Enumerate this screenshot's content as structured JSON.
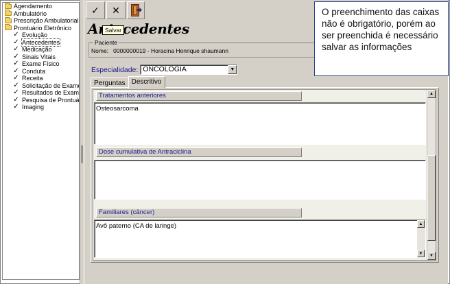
{
  "tree": {
    "items": [
      {
        "label": "Agendamento",
        "level": 0,
        "icon": "folder-icon"
      },
      {
        "label": "Ambulatório",
        "level": 0,
        "icon": "folder-icon"
      },
      {
        "label": "Prescrição Ambulatorial",
        "level": 0,
        "icon": "folder-icon"
      },
      {
        "label": "Prontuário Eletrônico",
        "level": 0,
        "icon": "folder-open-icon"
      },
      {
        "label": "Evolução",
        "level": 1,
        "icon": "check-icon"
      },
      {
        "label": "Antecedentes",
        "level": 1,
        "icon": "check-icon",
        "selected": true
      },
      {
        "label": "Medicação",
        "level": 1,
        "icon": "check-icon"
      },
      {
        "label": "Sinais Vitais",
        "level": 1,
        "icon": "check-icon"
      },
      {
        "label": "Exame Físico",
        "level": 1,
        "icon": "check-icon"
      },
      {
        "label": "Conduta",
        "level": 1,
        "icon": "check-icon"
      },
      {
        "label": "Receita",
        "level": 1,
        "icon": "check-icon"
      },
      {
        "label": "Solicitação de Exames",
        "level": 1,
        "icon": "check-icon"
      },
      {
        "label": "Resultados de Exames",
        "level": 1,
        "icon": "check-icon"
      },
      {
        "label": "Pesquisa de Prontuári",
        "level": 1,
        "icon": "check-icon"
      },
      {
        "label": "Imaging",
        "level": 1,
        "icon": "check-icon"
      }
    ]
  },
  "toolbar": {
    "save_glyph": "✓",
    "cancel_glyph": "✕",
    "tooltip": "Salvar"
  },
  "page": {
    "title": "Antecedentes"
  },
  "paciente": {
    "legend": "Paciente",
    "label": "Nome:",
    "id": "0000000019",
    "name": "Horacina Henrique shaumann"
  },
  "especialidade": {
    "label": "Especialidade:",
    "value": "ONCOLOGIA"
  },
  "tabs": [
    {
      "label": "Perguntas",
      "active": false
    },
    {
      "label": "Descritivo",
      "active": true
    }
  ],
  "sections": [
    {
      "header": "Tratamentos anteriores",
      "text": "Osteosarcoma"
    },
    {
      "header": "Dose cumulativa de Antraciclina",
      "text": ""
    },
    {
      "header": "Familiares (câncer)",
      "text": "Avô paterno (CA de laringe)"
    }
  ],
  "callout": {
    "text": "O preenchimento das caixas não é obrigatório, porém ao ser preenchida é necessário salvar as informações"
  },
  "colors": {
    "window_face": "#d4d0c8",
    "label_blue": "#1a1a8c",
    "callout_border": "#2a3f8f"
  }
}
